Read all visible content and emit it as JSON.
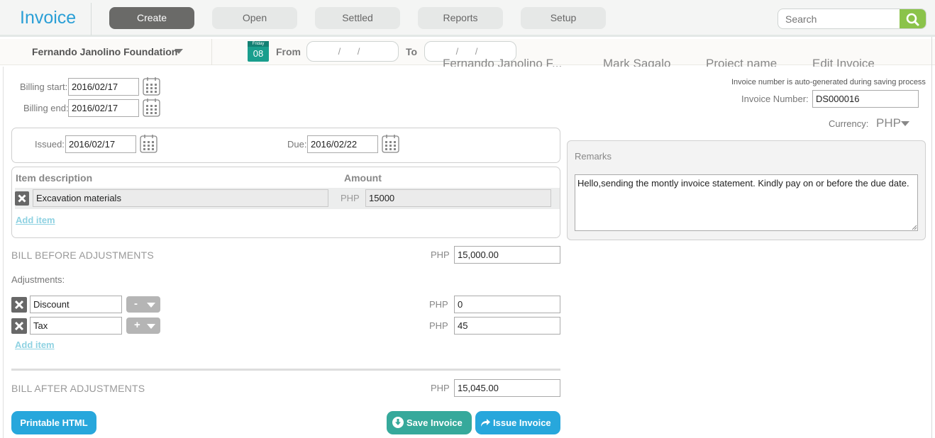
{
  "app": {
    "title": "Invoice"
  },
  "nav": {
    "create": "Create",
    "open": "Open",
    "settled": "Settled",
    "reports": "Reports",
    "setup": "Setup"
  },
  "search": {
    "placeholder": "Search"
  },
  "filter": {
    "client": "Fernando Janolino Foundation",
    "today_dow": "Friday",
    "today_day": "08",
    "from_label": "From",
    "from_value": "/ /",
    "to_label": "To",
    "to_value": "/ /"
  },
  "background_columns": [
    "Fernando Janolino F...",
    "Mark Sagalo",
    "Project name",
    "Edit Invoice"
  ],
  "billing": {
    "start_label": "Billing start:",
    "start_value": "2016/02/17",
    "end_label": "Billing end:",
    "end_value": "2016/02/17"
  },
  "dates": {
    "issued_label": "Issued:",
    "issued_value": "2016/02/17",
    "due_label": "Due:",
    "due_value": "2016/02/22"
  },
  "items": {
    "description_header": "Item description",
    "amount_header": "Amount",
    "rows": [
      {
        "description": "Excavation materials",
        "currency": "PHP",
        "amount": "15000"
      }
    ],
    "add_item": "Add item"
  },
  "bill_before": {
    "label": "BILL BEFORE ADJUSTMENTS",
    "currency": "PHP",
    "value": "15,000.00"
  },
  "adjustments": {
    "label": "Adjustments:",
    "rows": [
      {
        "name": "Discount",
        "operator": "-",
        "currency": "PHP",
        "value": "0"
      },
      {
        "name": "Tax",
        "operator": "+",
        "currency": "PHP",
        "value": "45"
      }
    ],
    "add_item": "Add item"
  },
  "bill_after": {
    "label": "BILL AFTER ADJUSTMENTS",
    "currency": "PHP",
    "value": "15,045.00"
  },
  "invoice_meta": {
    "auto_note": "Invoice number is auto-generated during saving process",
    "number_label": "Invoice Number:",
    "number_value": "DS000016",
    "currency_label": "Currency:",
    "currency_value": "PHP"
  },
  "remarks": {
    "label": "Remarks",
    "text": "Hello,sending the montly invoice statement. Kindly pay on or before the due date."
  },
  "actions": {
    "printable": "Printable HTML",
    "save": "Save Invoice",
    "issue": "Issue Invoice"
  },
  "colors": {
    "accent_blue": "#27a7dc",
    "teal": "#36a99b",
    "search_green": "#8bc34a",
    "nav_active": "#6a6a68"
  }
}
